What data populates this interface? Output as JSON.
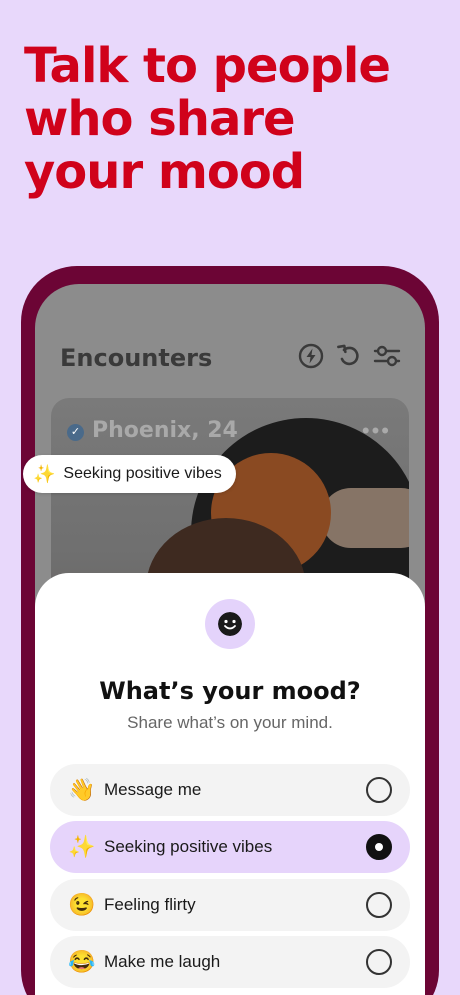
{
  "headline": [
    "Talk to people",
    "who share",
    "your mood"
  ],
  "encounters": {
    "title": "Encounters",
    "icons": [
      "bolt-circle-icon",
      "undo-icon",
      "filter-sliders-icon"
    ]
  },
  "profile": {
    "name": "Phoenix, 24",
    "verified_icon": "checkmark-icon",
    "more_icon": "more-dots-icon",
    "mood_emoji": "✨",
    "mood_text": "Seeking positive vibes"
  },
  "mood_sheet": {
    "title": "What’s your mood?",
    "subtitle": "Share what’s on your mind.",
    "options": [
      {
        "emoji": "👋",
        "label": "Message me",
        "selected": false
      },
      {
        "emoji": "✨",
        "label": "Seeking positive vibes",
        "selected": true
      },
      {
        "emoji": "😉",
        "label": "Feeling flirty",
        "selected": false
      },
      {
        "emoji": "😂",
        "label": "Make me laugh",
        "selected": false
      }
    ]
  },
  "colors": {
    "background": "#e8d8fb",
    "headline": "#d0021b",
    "phone_frame": "#6c0535",
    "selected_option": "#e6d4fb"
  }
}
